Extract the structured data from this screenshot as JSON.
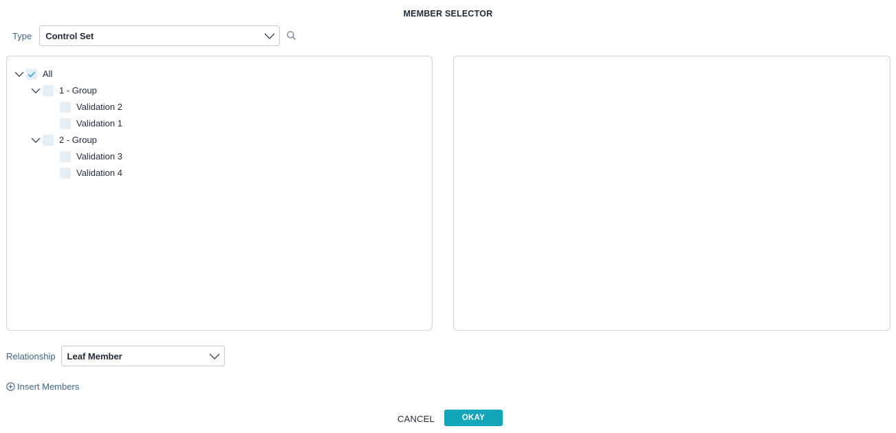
{
  "dialog": {
    "title": "MEMBER SELECTOR"
  },
  "type_field": {
    "label": "Type",
    "value": "Control Set",
    "chevron_icon": "chevron-down-icon",
    "search_icon": "search-icon"
  },
  "tree": {
    "nodes": [
      {
        "label": "All",
        "checked": true,
        "expanded": true,
        "level": 0
      },
      {
        "label": "1 - Group",
        "checked": false,
        "expanded": true,
        "level": 1
      },
      {
        "label": "Validation 2",
        "checked": false,
        "level": 2
      },
      {
        "label": "Validation 1",
        "checked": false,
        "level": 2
      },
      {
        "label": "2 - Group",
        "checked": false,
        "expanded": true,
        "level": 1
      },
      {
        "label": "Validation 3",
        "checked": false,
        "level": 2
      },
      {
        "label": "Validation 4",
        "checked": false,
        "level": 2
      }
    ]
  },
  "relationship_field": {
    "label": "Relationship",
    "value": "Leaf Member"
  },
  "insert_members": {
    "label": "Insert Members",
    "icon": "plus-circle-icon"
  },
  "footer": {
    "cancel_label": "CANCEL",
    "okay_label": "OKAY"
  },
  "colors": {
    "accent": "#13a5b9",
    "checkbox_bg": "#e3eff8",
    "check_mark": "#2f9fd8",
    "label_blue": "#3f6485",
    "border": "#c7ccd1"
  }
}
